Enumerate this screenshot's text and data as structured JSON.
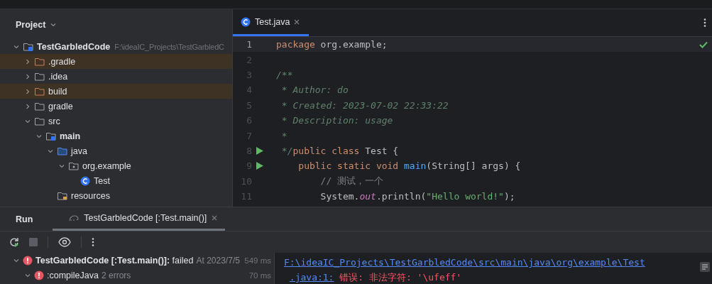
{
  "project": {
    "title": "Project",
    "tree": [
      {
        "label": "TestGarbledCode",
        "kind": "module",
        "expanded": true,
        "path": "F:\\ideaIC_Projects\\TestGarbledC",
        "children": [
          {
            "label": ".gradle",
            "kind": "excluded",
            "expanded": false
          },
          {
            "label": ".idea",
            "kind": "folder",
            "expanded": false
          },
          {
            "label": "build",
            "kind": "excluded",
            "expanded": false
          },
          {
            "label": "gradle",
            "kind": "folder",
            "expanded": false
          },
          {
            "label": "src",
            "kind": "folder",
            "expanded": true,
            "children": [
              {
                "label": "main",
                "kind": "module",
                "expanded": true,
                "children": [
                  {
                    "label": "java",
                    "kind": "source",
                    "expanded": true,
                    "children": [
                      {
                        "label": "org.example",
                        "kind": "package",
                        "expanded": true,
                        "children": [
                          {
                            "label": "Test",
                            "kind": "class"
                          }
                        ]
                      }
                    ]
                  },
                  {
                    "label": "resources",
                    "kind": "resources"
                  }
                ]
              }
            ]
          }
        ]
      }
    ]
  },
  "editor": {
    "tabs": [
      {
        "label": "Test.java",
        "selected": true
      }
    ],
    "lines": [
      {
        "number": "1",
        "current": true,
        "run_marker": false,
        "tokens": [
          {
            "text": "package",
            "kind": "keyword"
          },
          {
            "text": " org.example;",
            "kind": "plain"
          }
        ]
      },
      {
        "number": "2",
        "current": false,
        "run_marker": false
      },
      {
        "number": "3",
        "current": false,
        "run_marker": false,
        "tokens": [
          {
            "text": "/**",
            "kind": "doc"
          }
        ]
      },
      {
        "number": "4",
        "current": false,
        "run_marker": false,
        "tokens": [
          {
            "text": " * Author: do",
            "kind": "doc"
          }
        ]
      },
      {
        "number": "5",
        "current": false,
        "run_marker": false,
        "tokens": [
          {
            "text": " * Created: 2023-07-02 22:33:22",
            "kind": "doc"
          }
        ]
      },
      {
        "number": "6",
        "current": false,
        "run_marker": false,
        "tokens": [
          {
            "text": " * Description: usage",
            "kind": "doc"
          }
        ]
      },
      {
        "number": "7",
        "current": false,
        "run_marker": false,
        "tokens": [
          {
            "text": " *",
            "kind": "doc"
          }
        ]
      },
      {
        "number": "8",
        "current": false,
        "run_marker": true,
        "tokens": [
          {
            "text": " */",
            "kind": "doc"
          },
          {
            "text": "public class",
            "kind": "keyword"
          },
          {
            "text": " Test {",
            "kind": "plain"
          }
        ]
      },
      {
        "number": "9",
        "current": false,
        "run_marker": true,
        "tokens": [
          {
            "text": "    public static void ",
            "kind": "keyword"
          },
          {
            "text": "main",
            "kind": "method"
          },
          {
            "text": "(String[] args) {",
            "kind": "plain"
          }
        ]
      },
      {
        "number": "10",
        "current": false,
        "run_marker": false,
        "tokens": [
          {
            "text": "        // 测试，一个",
            "kind": "comment"
          }
        ]
      },
      {
        "number": "11",
        "current": false,
        "run_marker": false,
        "tokens": [
          {
            "text": "        System.",
            "kind": "plain"
          },
          {
            "text": "out",
            "kind": "static"
          },
          {
            "text": ".println(",
            "kind": "plain"
          },
          {
            "text": "\"Hello world!\"",
            "kind": "string"
          },
          {
            "text": ");",
            "kind": "plain"
          }
        ]
      }
    ]
  },
  "run": {
    "title": "Run",
    "tabs": [
      {
        "label": "TestGarbledCode [:Test.main()]",
        "selected": true
      }
    ],
    "tree": [
      {
        "name": "TestGarbledCode [:Test.main()]:",
        "result": "failed",
        "detail": "At 2023/7/5",
        "time": "549 ms",
        "expanded": true,
        "children": [
          {
            "name": ":compileJava",
            "detail": "2 errors",
            "time": "70 ms",
            "expanded": true
          }
        ]
      }
    ],
    "console": [
      {
        "link": "F:\\ideaIC_Projects\\TestGarbledCode\\src\\main\\java\\org\\example\\Test"
      },
      {
        "link": ".java:1:",
        "error": "错误: 非法字符: '\\ufeff'"
      }
    ]
  }
}
